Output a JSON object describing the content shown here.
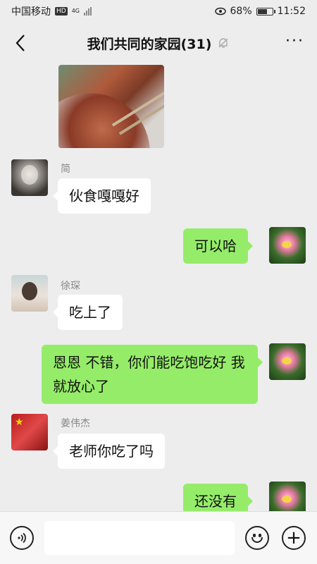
{
  "status_bar": {
    "carrier": "中国移动",
    "hd_badge": "HD",
    "network": "4G",
    "battery_percent": "68%",
    "time": "11:52"
  },
  "header": {
    "title": "我们共同的家园(31)",
    "more_label": "···"
  },
  "messages": [
    {
      "sender": "简",
      "text": "伙食嘎嘎好",
      "side": "left"
    },
    {
      "sender": "",
      "text": "可以哈",
      "side": "right"
    },
    {
      "sender": "徐琛",
      "text": "吃上了",
      "side": "left"
    },
    {
      "sender": "",
      "text": "恩恩  不错，你们能吃饱吃好 我就放心了",
      "side": "right"
    },
    {
      "sender": "姜伟杰",
      "text": "老师你吃了吗",
      "side": "left"
    },
    {
      "sender": "",
      "text": "还没有",
      "side": "right"
    }
  ],
  "input": {
    "value": "",
    "plus_label": "+"
  },
  "colors": {
    "chat_background": "#ededed",
    "outgoing_bubble": "#95ec69",
    "incoming_bubble": "#ffffff"
  },
  "icons": [
    "back-icon",
    "mute-bell-icon",
    "more-icon",
    "voice-icon",
    "emoji-icon",
    "plus-icon"
  ]
}
